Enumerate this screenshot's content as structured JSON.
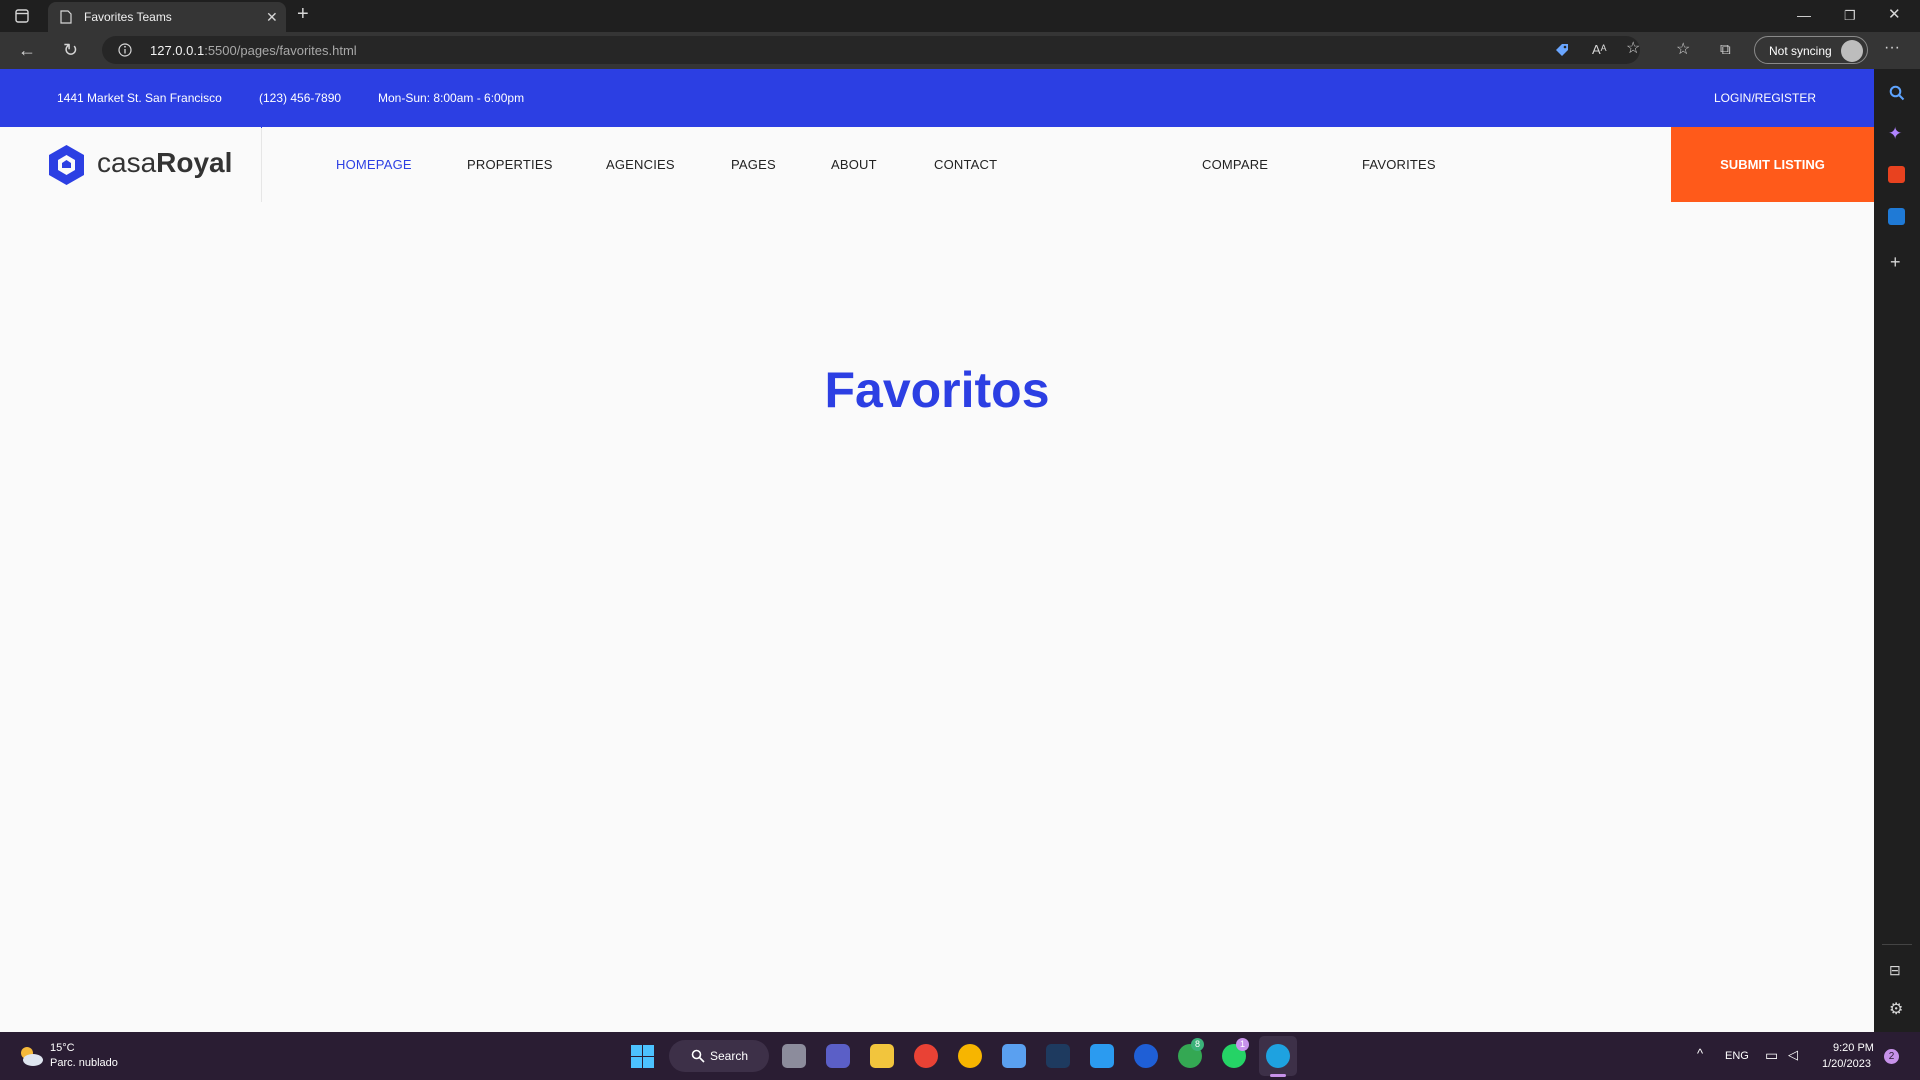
{
  "browser": {
    "tab_title": "Favorites Teams",
    "url_host": "127.0.0.1",
    "url_rest": ":5500/pages/favorites.html",
    "sync_label": "Not syncing"
  },
  "site_top": {
    "address": "1441 Market St. San Francisco",
    "phone": "(123) 456-7890",
    "hours": "Mon-Sun: 8:00am - 6:00pm",
    "login": "LOGIN/REGISTER"
  },
  "logo": {
    "light": "casa",
    "bold": "Royal"
  },
  "nav": {
    "items": [
      "HOMEPAGE",
      "PROPERTIES",
      "AGENCIES",
      "PAGES",
      "ABOUT",
      "CONTACT",
      "COMPARE",
      "FAVORITES"
    ],
    "submit": "SUBMIT LISTING"
  },
  "page": {
    "heading": "Favoritos"
  },
  "colors": {
    "brand_blue": "#2c3fe3",
    "accent_orange": "#ff5a1a"
  },
  "taskbar": {
    "temp": "15°C",
    "weather": "Parc. nublado",
    "search": "Search",
    "lang": "ENG",
    "time": "9:20 PM",
    "date": "1/20/2023",
    "notif_count": "2",
    "badge_a": "8",
    "badge_b": "1"
  }
}
